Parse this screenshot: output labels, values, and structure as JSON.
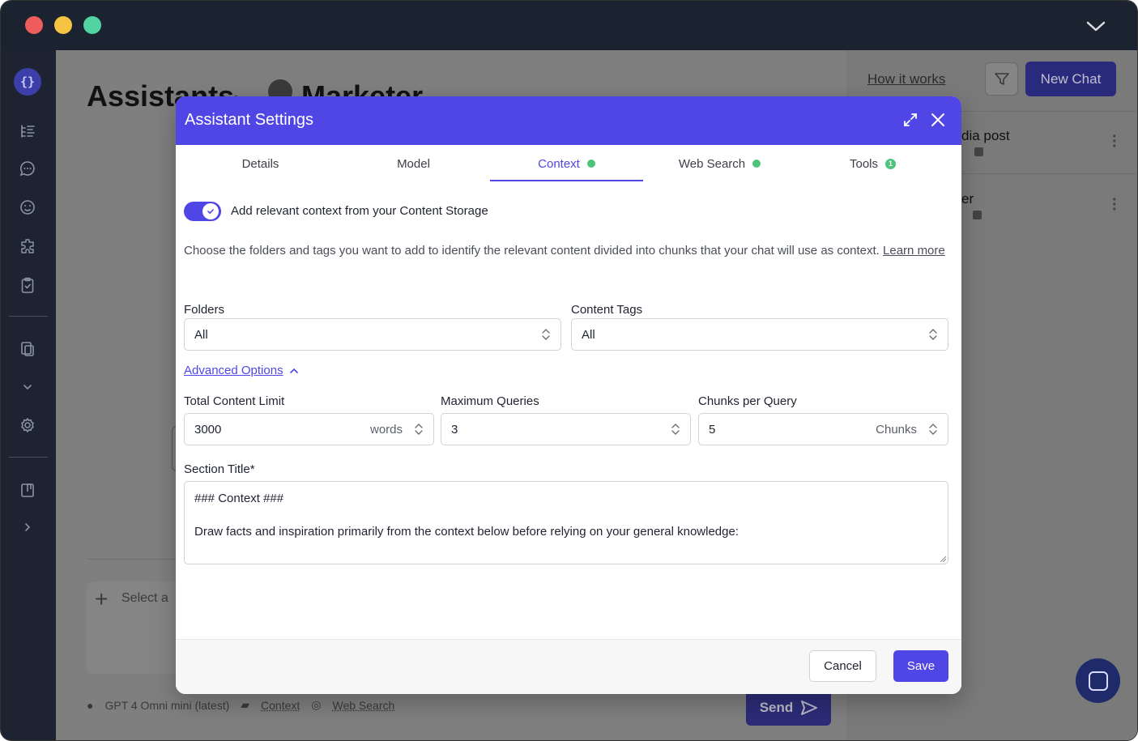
{
  "window": {
    "traffic_lights": [
      "close",
      "minimize",
      "maximize"
    ]
  },
  "background": {
    "breadcrumb_root": "Assistants",
    "breadcrumb_current": "Marketer",
    "chat_input_placeholder": "Select a",
    "footer_model": "GPT 4 Omni mini (latest)",
    "footer_context": "Context",
    "footer_web_search": "Web Search",
    "send_label": "Send",
    "right_panel": {
      "how_it_works": "How it works",
      "new_chat": "New Chat",
      "items": [
        {
          "title": "dia post"
        },
        {
          "title": "er"
        }
      ]
    }
  },
  "modal": {
    "title": "Assistant Settings",
    "tabs": [
      {
        "label": "Details",
        "status": ""
      },
      {
        "label": "Model",
        "status": ""
      },
      {
        "label": "Context",
        "status": "dot"
      },
      {
        "label": "Web Search",
        "status": "dot"
      },
      {
        "label": "Tools",
        "status": "1"
      }
    ],
    "active_tab": "Context",
    "toggle_label": "Add relevant context from your Content Storage",
    "toggle_on": true,
    "description": "Choose the folders and tags you want to add to identify the relevant content divided into chunks that your chat will use as context.",
    "learn_more": "Learn more",
    "folders_label": "Folders",
    "folders_value": "All",
    "tags_label": "Content Tags",
    "tags_value": "All",
    "advanced_options": "Advanced Options",
    "total_limit_label": "Total Content Limit",
    "total_limit_value": "3000",
    "total_limit_unit": "words",
    "max_queries_label": "Maximum Queries",
    "max_queries_value": "3",
    "chunks_label": "Chunks per Query",
    "chunks_value": "5",
    "chunks_unit": "Chunks",
    "section_title_label": "Section Title*",
    "section_title_line1": "### Context ###",
    "section_title_line2": "Draw facts and inspiration primarily from the context below before relying on your general knowledge:",
    "cancel": "Cancel",
    "save": "Save"
  },
  "colors": {
    "accent": "#4f46e5",
    "status_green": "#4cc47c",
    "sidebar_bg": "#1d2331"
  }
}
